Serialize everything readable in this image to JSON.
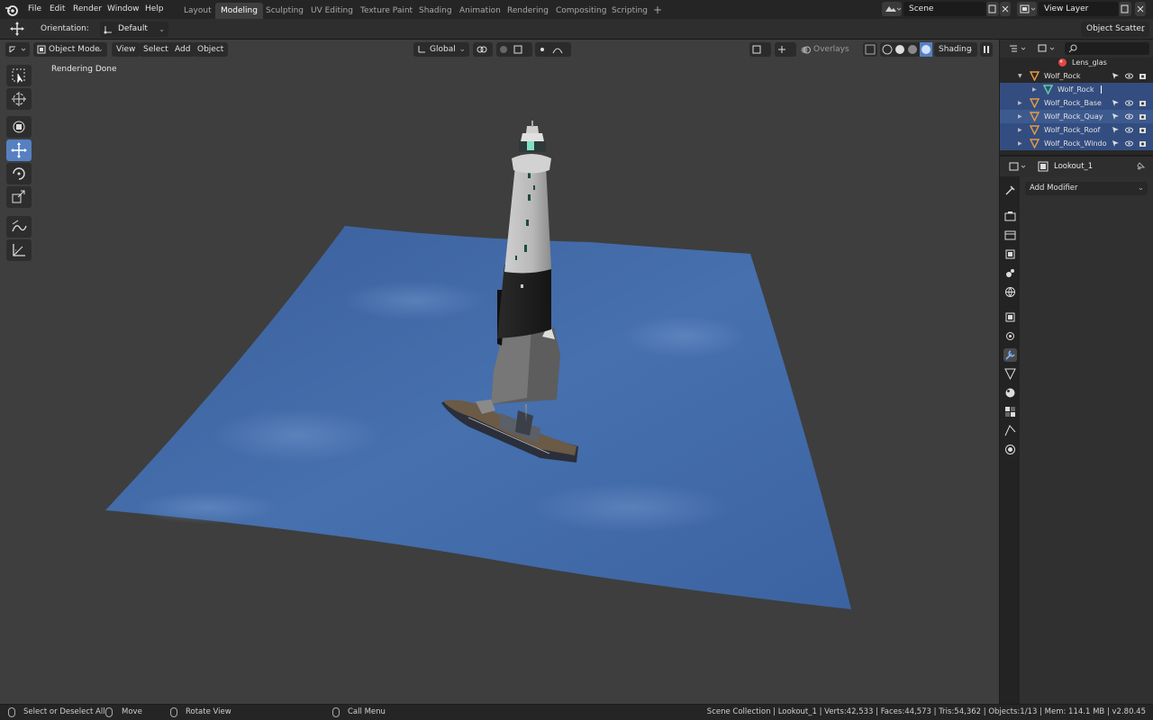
{
  "menu": [
    "File",
    "Edit",
    "Render",
    "Window",
    "Help"
  ],
  "workspace_tabs": [
    "Layout",
    "Modeling",
    "Sculpting",
    "UV Editing",
    "Texture Paint",
    "Shading",
    "Animation",
    "Rendering",
    "Compositing",
    "Scripting"
  ],
  "active_tab": "Modeling",
  "scene": "Scene",
  "view_layer": "View Layer",
  "tool_settings": {
    "orientation_label": "Orientation:",
    "orientation_value": "Default",
    "right_dropdown": "Object Scatter"
  },
  "viewport": {
    "mode": "Object Mode",
    "menus": [
      "View",
      "Select",
      "Add",
      "Object"
    ],
    "transform_orientation": "Global",
    "overlays": "Overlays",
    "shading": "Shading",
    "message": "Rendering Done"
  },
  "outliner": {
    "rows": [
      {
        "name": "Lens_glas",
        "icon": "material-icon"
      },
      {
        "name": "Wolf_Rock",
        "icon": "mesh-object-icon"
      },
      {
        "name": "Wolf_Rock",
        "icon": "mesh-data-icon"
      },
      {
        "name": "Wolf_Rock_Base",
        "icon": "mesh-object-icon"
      },
      {
        "name": "Wolf_Rock_Quay",
        "icon": "mesh-object-icon"
      },
      {
        "name": "Wolf_Rock_Roof",
        "icon": "mesh-object-icon"
      },
      {
        "name": "Wolf_Rock_Windo",
        "icon": "mesh-object-icon"
      }
    ]
  },
  "properties": {
    "object_name": "Lookout_1",
    "add_modifier": "Add Modifier"
  },
  "statusbar": {
    "hint1": "Select or Deselect All",
    "hint2": "Move",
    "hint3": "Rotate View",
    "hint4": "Call Menu",
    "stats": "Scene Collection | Lookout_1 | Verts:42,533 | Faces:44,573 | Tris:54,362 | Objects:1/13 | Mem: 114.1 MB | v2.80.45"
  },
  "colors": {
    "accent": "#5680c2",
    "water": "#3f67a8",
    "viewport_bg": "#3e3e3e"
  }
}
